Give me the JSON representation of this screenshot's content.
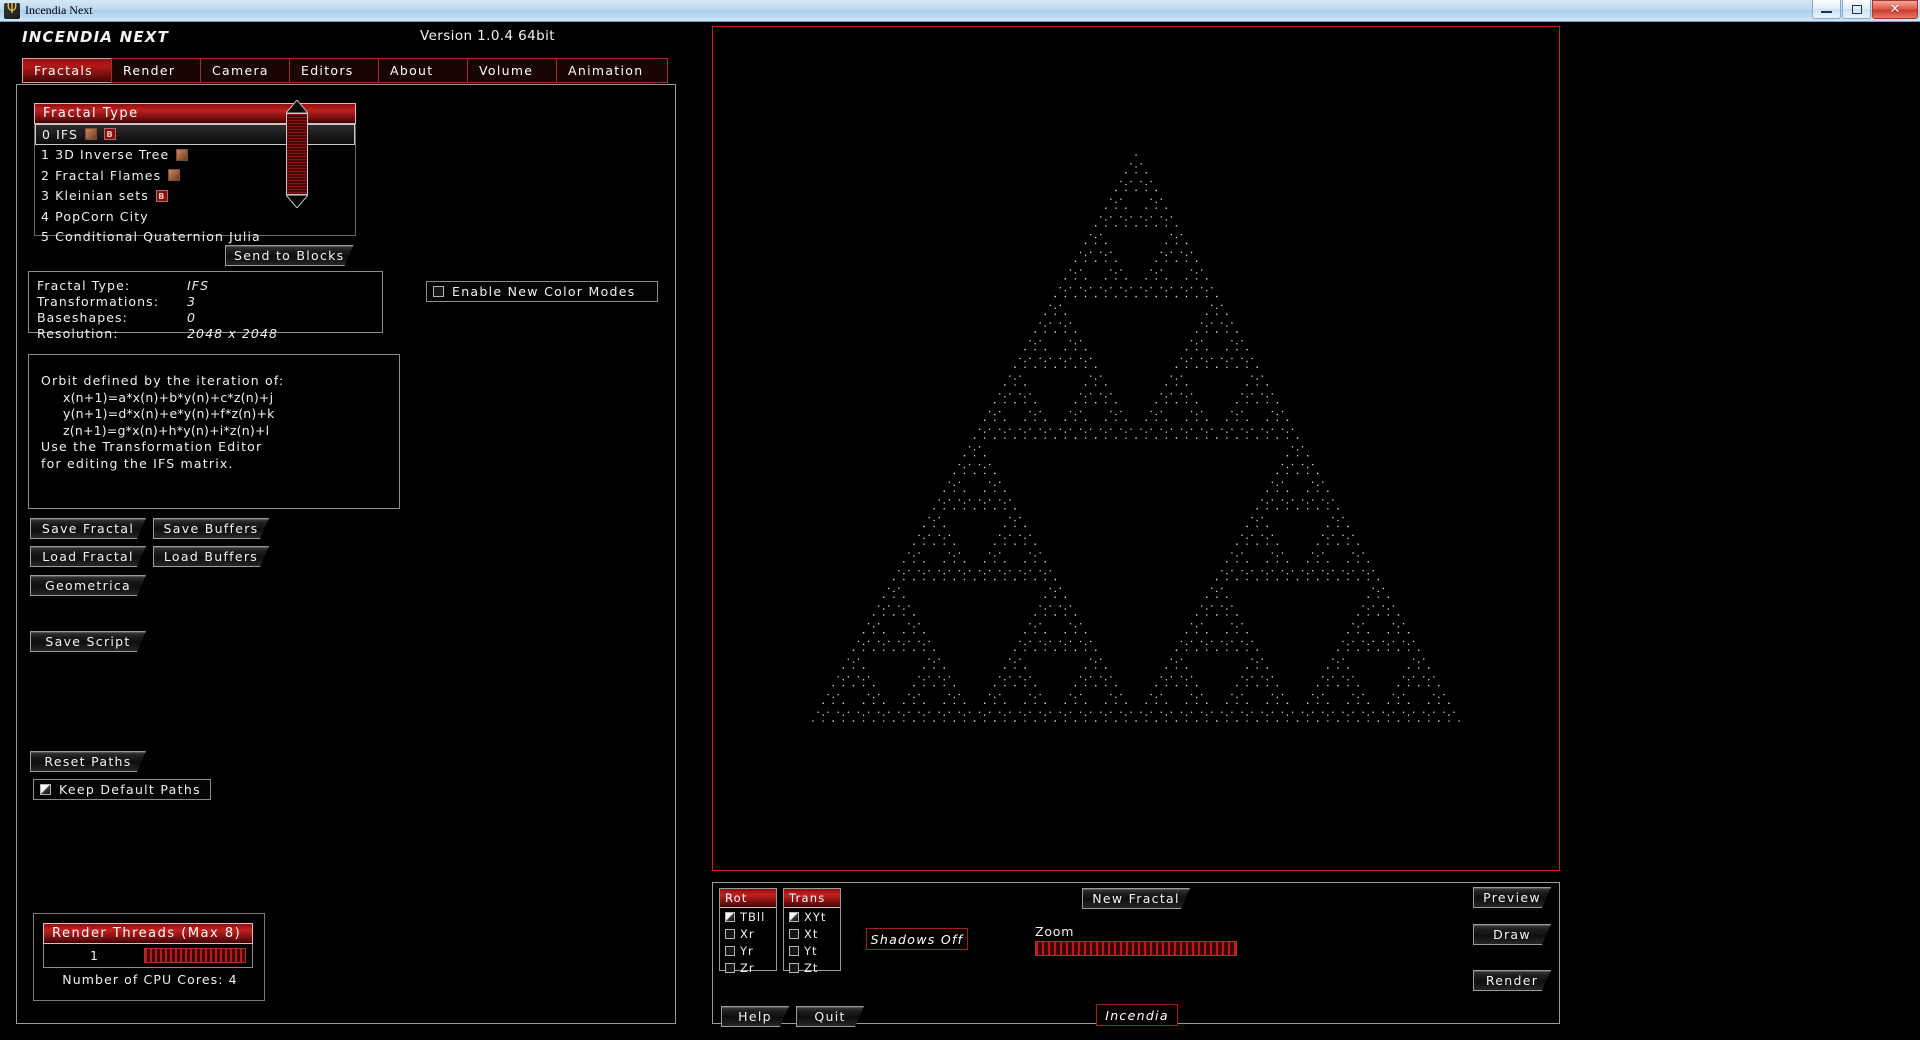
{
  "window": {
    "title": "Incendia Next",
    "icon": "app-icon",
    "buttons": {
      "minimize": "minimize-icon",
      "maximize": "maximize-icon",
      "close": "close-icon"
    }
  },
  "header": {
    "app_title": "INCENDIA NEXT",
    "version": "Version 1.0.4 64bit"
  },
  "menu": {
    "tabs": [
      {
        "label": "Fractals",
        "active": true
      },
      {
        "label": "Render",
        "active": false
      },
      {
        "label": "Camera",
        "active": false
      },
      {
        "label": "Editors",
        "active": false
      },
      {
        "label": "About",
        "active": false
      },
      {
        "label": "Volume",
        "active": false
      },
      {
        "label": "Animation",
        "active": false
      }
    ]
  },
  "fractal_type": {
    "header": "Fractal Type",
    "items": [
      {
        "index": "0",
        "label": "IFS",
        "tags": [
          "img",
          "b"
        ],
        "selected": true
      },
      {
        "index": "1",
        "label": "3D Inverse Tree",
        "tags": [
          "img"
        ],
        "selected": false
      },
      {
        "index": "2",
        "label": "Fractal Flames",
        "tags": [
          "img"
        ],
        "selected": false
      },
      {
        "index": "3",
        "label": "Kleinian sets",
        "tags": [
          "b"
        ],
        "selected": false
      },
      {
        "index": "4",
        "label": "PopCorn City",
        "tags": [],
        "selected": false
      },
      {
        "index": "5",
        "label": "Conditional Quaternion Julia",
        "tags": [],
        "selected": false
      }
    ],
    "tag_b_text": "B",
    "scrollbar": {
      "up": "scroll-up-arrow",
      "down": "scroll-down-arrow"
    },
    "send_to_blocks": "Send to Blocks"
  },
  "options": {
    "enable_new_color_modes": {
      "label": "Enable New Color Modes",
      "checked": false
    }
  },
  "stats": {
    "rows": [
      {
        "label": "Fractal Type:",
        "value": "IFS"
      },
      {
        "label": "Transformations:",
        "value": "3"
      },
      {
        "label": "Baseshapes:",
        "value": "0"
      },
      {
        "label": "Resolution:",
        "value": "2048 x 2048"
      }
    ]
  },
  "orbit": {
    "lines": [
      "Orbit defined by the iteration of:",
      "x(n+1)=a*x(n)+b*y(n)+c*z(n)+j",
      "y(n+1)=d*x(n)+e*y(n)+f*z(n)+k",
      "z(n+1)=g*x(n)+h*y(n)+i*z(n)+l",
      "Use the Transformation Editor",
      "for editing the IFS matrix."
    ]
  },
  "actions": {
    "save_fractal": "Save Fractal",
    "save_buffers": "Save Buffers",
    "load_fractal": "Load Fractal",
    "load_buffers": "Load Buffers",
    "geometrica": "Geometrica",
    "save_script": "Save Script",
    "reset_paths": "Reset Paths",
    "keep_default_paths": {
      "label": "Keep Default Paths",
      "checked": true
    }
  },
  "threads": {
    "header": "Render Threads (Max 8)",
    "value": "1",
    "cpu_cores": "Number of CPU Cores: 4"
  },
  "controls": {
    "rot": {
      "header": "Rot",
      "items": [
        {
          "label": "TBll",
          "checked": true
        },
        {
          "label": "Xr",
          "checked": false
        },
        {
          "label": "Yr",
          "checked": false
        },
        {
          "label": "Zr",
          "checked": false
        }
      ]
    },
    "trans": {
      "header": "Trans",
      "items": [
        {
          "label": "XYt",
          "checked": true
        },
        {
          "label": "Xt",
          "checked": false
        },
        {
          "label": "Yt",
          "checked": false
        },
        {
          "label": "Zt",
          "checked": false
        }
      ]
    },
    "shadows": "Shadows Off",
    "new_fractal": "New Fractal",
    "zoom_label": "Zoom",
    "brand": "Incendia",
    "preview": "Preview",
    "draw": "Draw",
    "render": "Render",
    "help": "Help",
    "quit": "Quit"
  },
  "viewport": {
    "accent_color": "#cf1f1f",
    "fractal": "sierpinski-triangle",
    "point_color": "#d8d8d8"
  }
}
